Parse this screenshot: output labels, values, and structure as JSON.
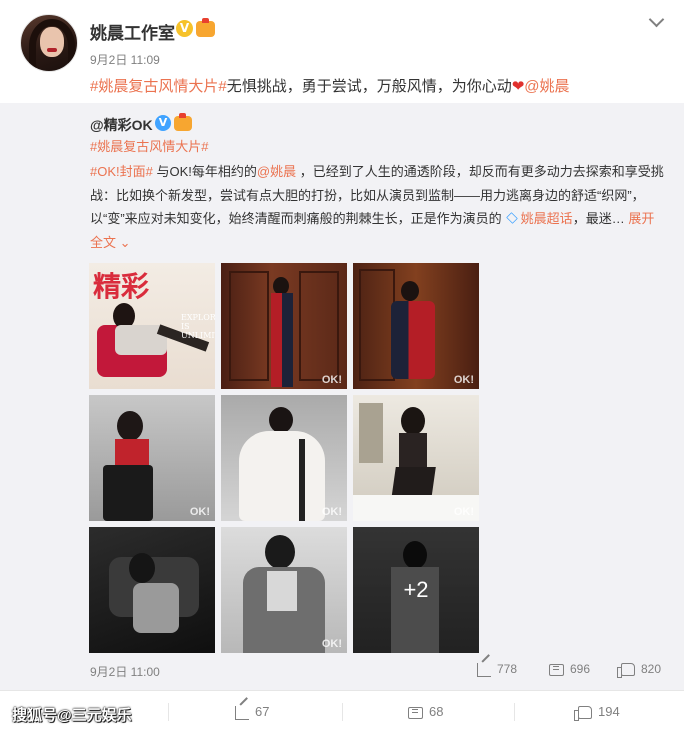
{
  "post": {
    "author": "姚晨工作室",
    "verified_icon": "v-badge-icon",
    "member_icon": "member-crown-icon",
    "time": "9月2日 11:09",
    "text_link1": "#姚晨复古风情大片#",
    "text_plain": "无惧挑战，勇于尝试，万般风情，为你心动",
    "text_link2": "@姚晨"
  },
  "repost": {
    "author": "@精彩OK",
    "tag": "#姚晨复古风情大片#",
    "line1_link1": "#OK!封面#",
    "line1_plain1": " 与OK!每年相约的",
    "line1_link2": "@姚晨",
    "line1_plain2": " ，已经到了人生的通透阶段，却反而有更多动力去探索和享受挑战：比如换个新发型，尝试有点大胆的打扮，比如从演员到监制——用力逃离身边的舒适“织网”，以“变”来应对未知变化，始终清醒而刺痛般的荆棘生长，正是作为演员的",
    "topic_link": "姚晨超话",
    "tail": "，最迷…",
    "expand": "展开全文",
    "photos_more": "+2",
    "photo_watermark": "OK!",
    "time": "9月2日 11:00",
    "shares": "778",
    "comments": "696",
    "likes": "820"
  },
  "footer": {
    "watermark": "搜狐号@三元娱乐",
    "shares": "67",
    "comments": "68",
    "likes": "194"
  },
  "colors": {
    "link": "#eb7350",
    "repost_bg": "#f2f2f5",
    "muted": "#808080"
  }
}
